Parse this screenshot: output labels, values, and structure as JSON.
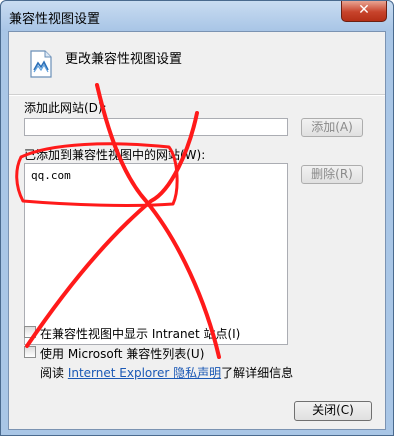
{
  "window": {
    "title": "兼容性视图设置",
    "close_glyph": "✕"
  },
  "header": {
    "text": "更改兼容性视图设置",
    "icon": "compat-view-page-icon"
  },
  "add_site": {
    "label": "添加此网站(D):",
    "value": "",
    "button": "添加(A)"
  },
  "sites": {
    "label": "已添加到兼容性视图中的网站(W):",
    "items": [
      "qq.com"
    ],
    "remove_button": "删除(R)"
  },
  "options": [
    {
      "label": "在兼容性视图中显示 Intranet 站点(I)",
      "checked": false
    },
    {
      "label": "使用 Microsoft 兼容性列表(U)",
      "checked": false
    }
  ],
  "privacy": {
    "prefix": "阅读 ",
    "link": "Internet Explorer 隐私声明",
    "suffix": "了解详细信息"
  },
  "footer": {
    "close_button": "关闭(C)"
  },
  "colors": {
    "annotation_red": "#ff1a1a",
    "title_bg": "#a9c6e6",
    "link": "#1a58b5"
  }
}
